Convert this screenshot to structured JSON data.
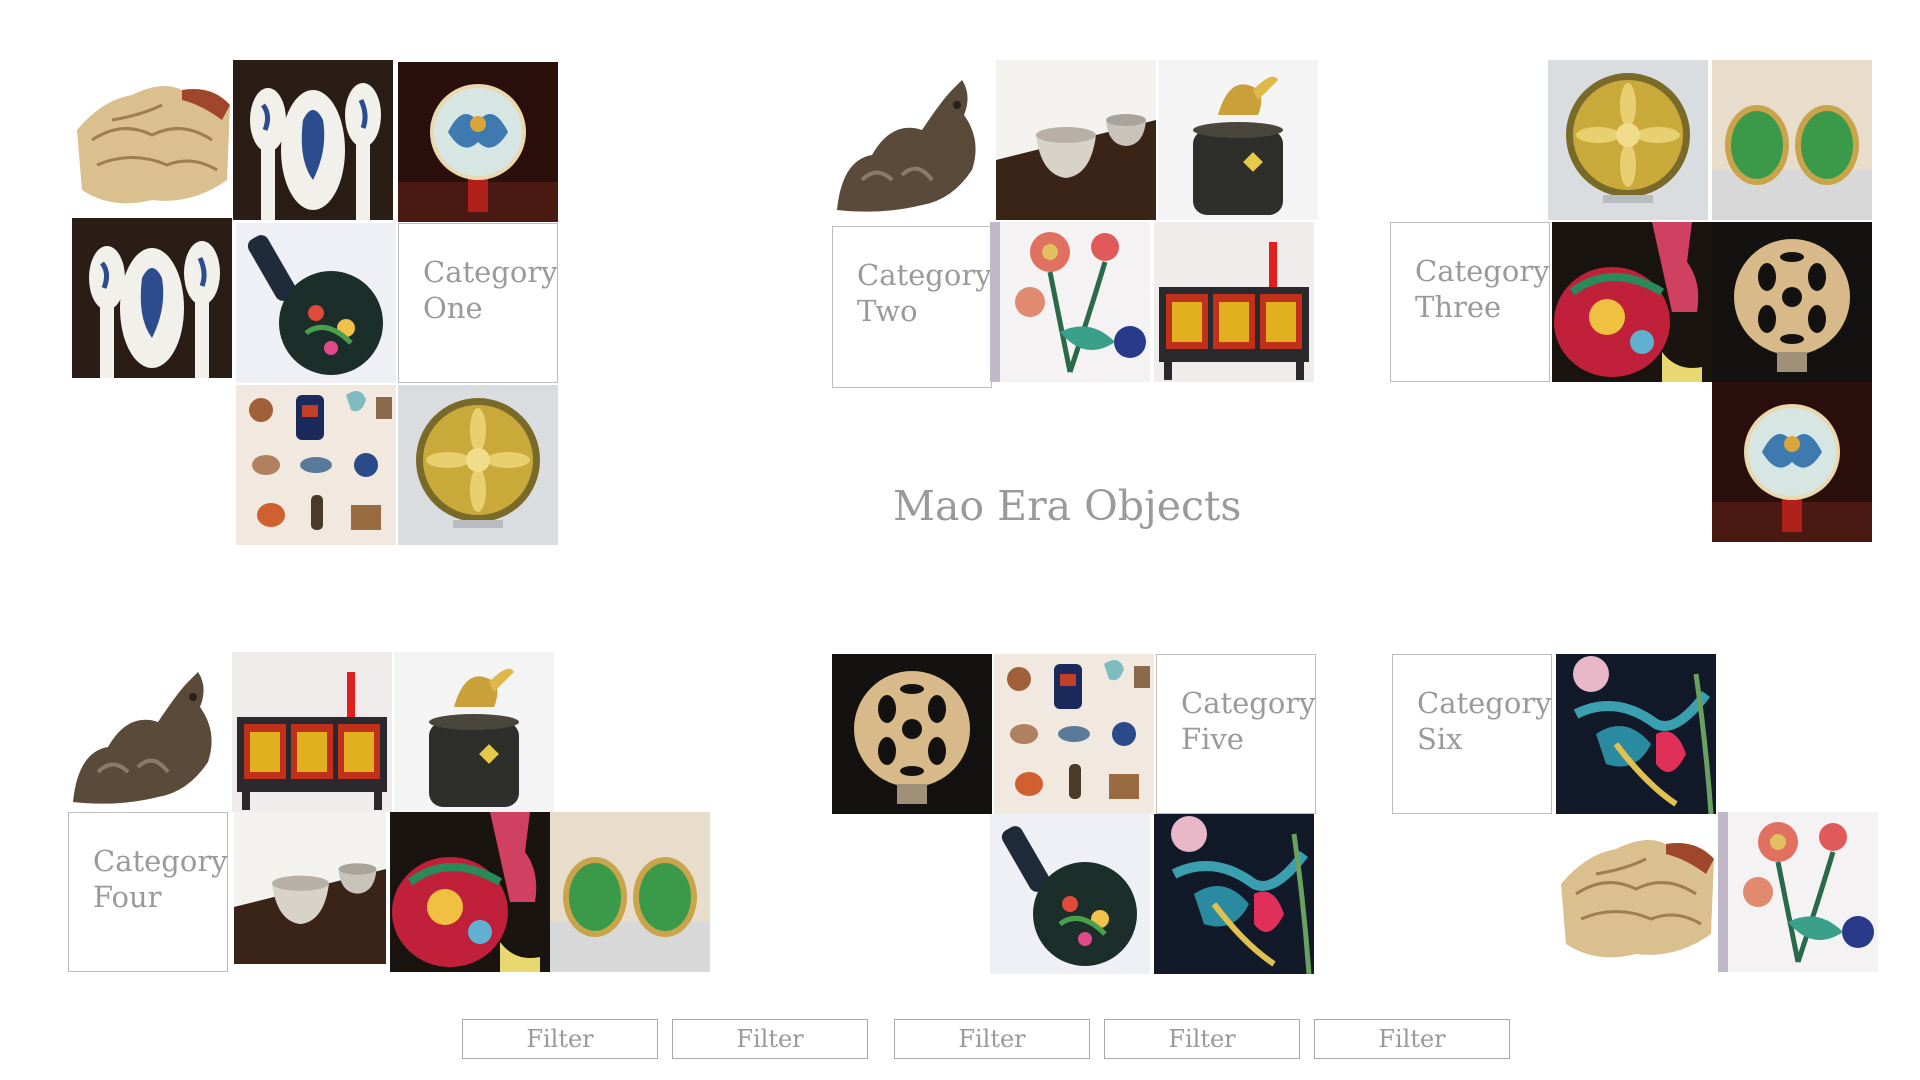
{
  "page_title": "Mao Era Objects",
  "categories": [
    {
      "line1": "Category",
      "line2": "One"
    },
    {
      "line1": "Category",
      "line2": "Two"
    },
    {
      "line1": "Category",
      "line2": "Three"
    },
    {
      "line1": "Category",
      "line2": "Four"
    },
    {
      "line1": "Category",
      "line2": "Five"
    },
    {
      "line1": "Category",
      "line2": "Six"
    }
  ],
  "filters": [
    "Filter",
    "Filter",
    "Filter",
    "Filter",
    "Filter"
  ],
  "colors": {
    "background": "#ffffff",
    "text_gray": "#9a9a9a",
    "border_gray": "#bdbdbd"
  }
}
